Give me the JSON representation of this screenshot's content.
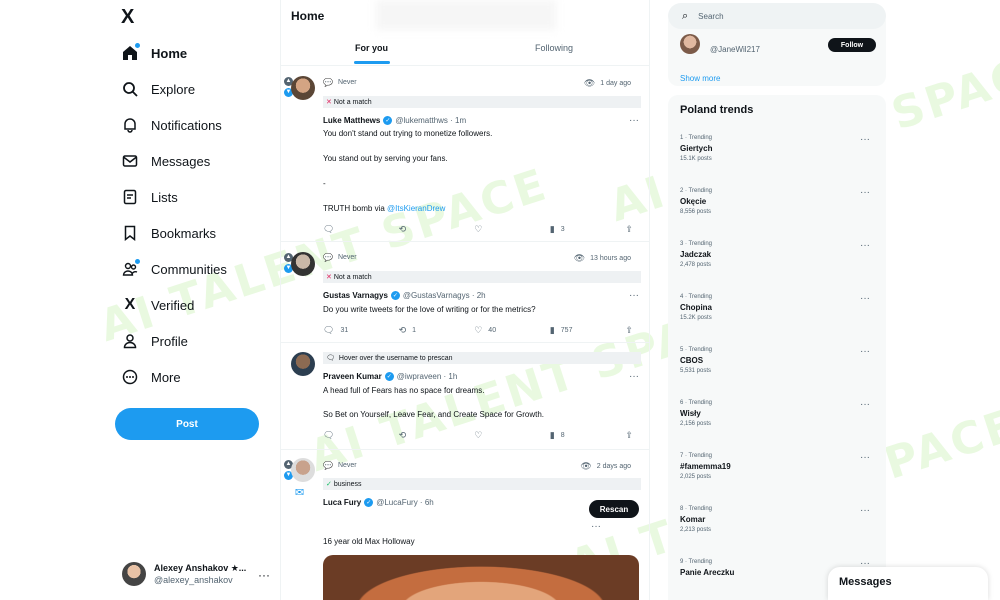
{
  "nav": {
    "logo": "X",
    "items": [
      {
        "label": "Home",
        "icon": "home-icon"
      },
      {
        "label": "Explore",
        "icon": "search-icon"
      },
      {
        "label": "Notifications",
        "icon": "bell-icon"
      },
      {
        "label": "Messages",
        "icon": "mail-icon"
      },
      {
        "label": "Lists",
        "icon": "list-icon"
      },
      {
        "label": "Bookmarks",
        "icon": "bookmark-icon"
      },
      {
        "label": "Communities",
        "icon": "people-icon"
      },
      {
        "label": "Verified",
        "icon": "x-logo-icon"
      },
      {
        "label": "Profile",
        "icon": "person-icon"
      },
      {
        "label": "More",
        "icon": "more-circle-icon"
      }
    ],
    "post_label": "Post"
  },
  "account": {
    "name": "Alexey Anshakov ★...",
    "handle": "@alexey_anshakov",
    "more": "···"
  },
  "main": {
    "title": "Home",
    "tabs": [
      {
        "label": "For you"
      },
      {
        "label": "Following"
      }
    ]
  },
  "tweets": [
    {
      "meta": "Never",
      "ago": "1 day ago",
      "tag": "Not a match",
      "name": "Luke Matthews",
      "handle": "@lukematthws · 1m",
      "lines": [
        "You don't stand out trying to monetize followers.",
        "You stand out by serving your fans.",
        "-"
      ],
      "last_line_prefix": "TRUTH bomb via ",
      "last_line_link": "@ItsKieranDrew",
      "actions": {
        "replies": "",
        "retweets": "",
        "likes": "",
        "views": "3"
      }
    },
    {
      "meta": "Never",
      "ago": "13 hours ago",
      "tag": "Not a match",
      "name": "Gustas Varnagys",
      "handle": "@GustasVarnagys · 2h",
      "lines": [
        "Do you write tweets for the love of writing or for the metrics?"
      ],
      "actions": {
        "replies": "31",
        "retweets": "1",
        "likes": "40",
        "views": "757"
      }
    },
    {
      "meta": "Hover over the username to prescan",
      "name": "Praveen Kumar",
      "handle": "@iwpraveen · 1h",
      "lines": [
        "A head full of Fears has no space for dreams.",
        "So Bet on Yourself, Leave Fear, and Create Space for Growth."
      ],
      "actions": {
        "replies": "",
        "retweets": "",
        "likes": "",
        "views": "8"
      }
    },
    {
      "meta": "Never",
      "ago": "2 days ago",
      "tag": "business",
      "name": "Luca Fury",
      "handle": "@LucaFury · 6h",
      "rescan": "Rescan",
      "lines": [
        "16 year old Max Holloway"
      ]
    }
  ],
  "right": {
    "search_placeholder": "Search",
    "suggested_handle": "@JaneWil217",
    "follow_label": "Follow",
    "show_more": "Show more",
    "trends_title": "Poland trends",
    "trends": [
      {
        "ctx": "1 · Trending",
        "name": "Giertych",
        "count": "15.1K posts"
      },
      {
        "ctx": "2 · Trending",
        "name": "Okęcie",
        "count": "8,556 posts"
      },
      {
        "ctx": "3 · Trending",
        "name": "Jadczak",
        "count": "2,478 posts"
      },
      {
        "ctx": "4 · Trending",
        "name": "Chopina",
        "count": "15.2K posts"
      },
      {
        "ctx": "5 · Trending",
        "name": "CBOS",
        "count": "5,531 posts"
      },
      {
        "ctx": "6 · Trending",
        "name": "Wisły",
        "count": "2,156 posts"
      },
      {
        "ctx": "7 · Trending",
        "name": "#famemma19",
        "count": "2,025 posts"
      },
      {
        "ctx": "8 · Trending",
        "name": "Komar",
        "count": "2,213 posts"
      },
      {
        "ctx": "9 · Trending",
        "name": "Panie Areczku",
        "count": ""
      }
    ]
  },
  "messages_drawer": "Messages",
  "watermark": "AI TALENT SPACE"
}
